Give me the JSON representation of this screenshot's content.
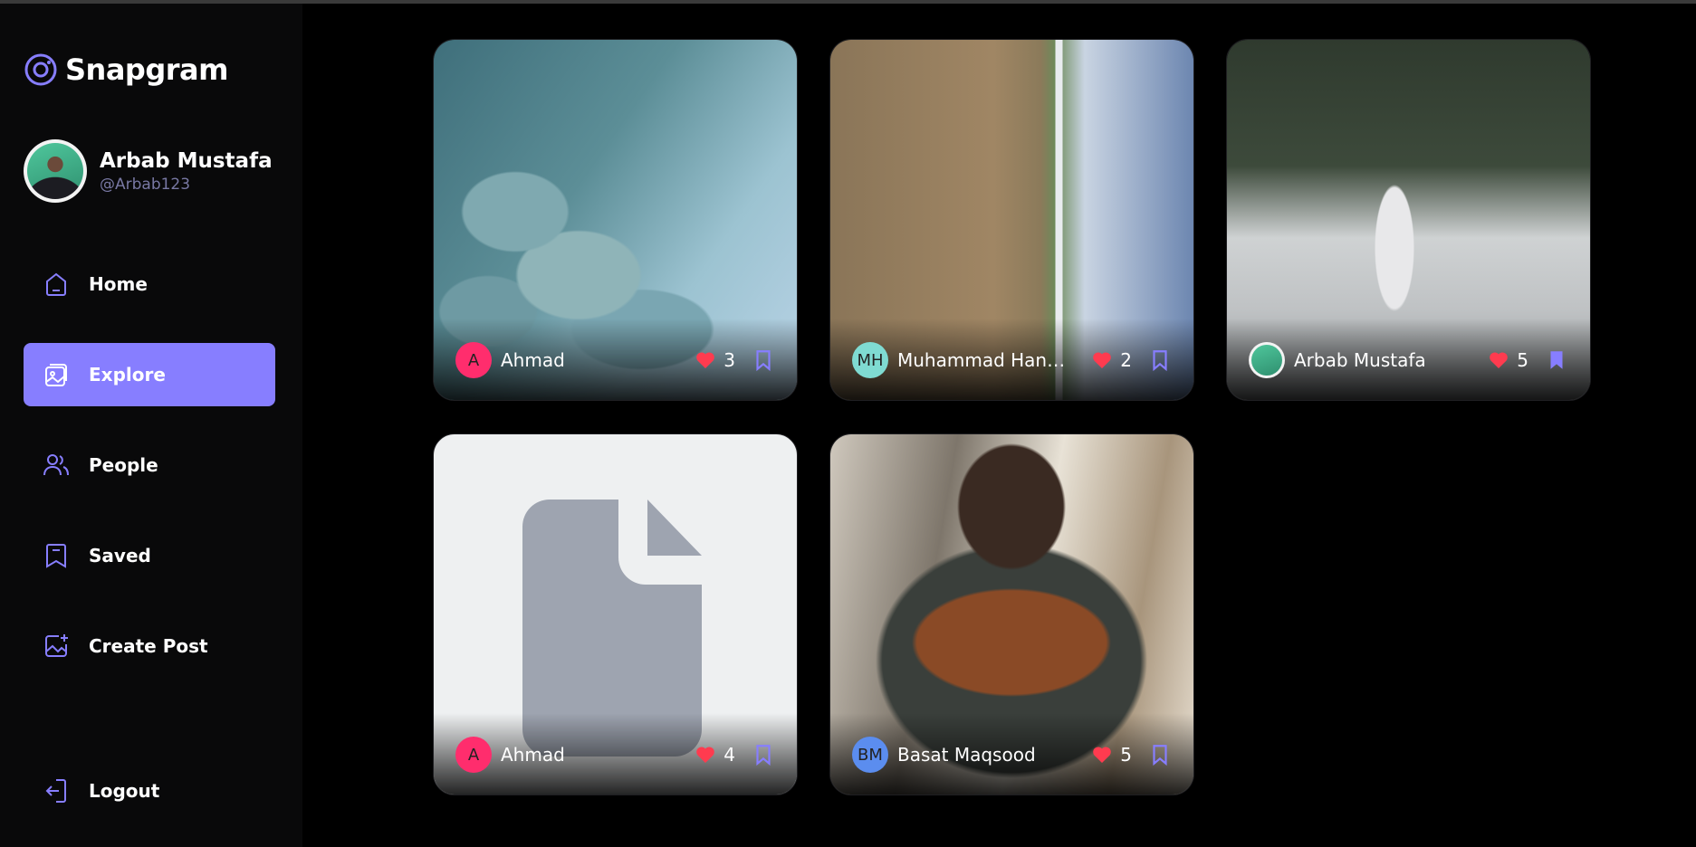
{
  "app": {
    "name": "Snapgram"
  },
  "user": {
    "name": "Arbab Mustafa",
    "handle": "@Arbab123"
  },
  "nav": {
    "home": "Home",
    "explore": "Explore",
    "people": "People",
    "saved": "Saved",
    "create": "Create Post",
    "logout": "Logout"
  },
  "colors": {
    "accent": "#877eff",
    "like": "#ff3b4f"
  },
  "posts": [
    {
      "initials": "A",
      "author": "Ahmad",
      "likes": "3",
      "avatar_color": "#ff2d6d",
      "saved": false
    },
    {
      "initials": "MH",
      "author": "Muhammad Hanzl...",
      "likes": "2",
      "avatar_color": "#7fdbd2",
      "saved": false
    },
    {
      "initials": "",
      "author": "Arbab Mustafa",
      "likes": "5",
      "avatar_color": "#3fbf8f",
      "saved": true
    },
    {
      "initials": "A",
      "author": "Ahmad",
      "likes": "4",
      "avatar_color": "#ff2d6d",
      "saved": false
    },
    {
      "initials": "BM",
      "author": "Basat Maqsood",
      "likes": "5",
      "avatar_color": "#5b8def",
      "saved": false
    }
  ]
}
